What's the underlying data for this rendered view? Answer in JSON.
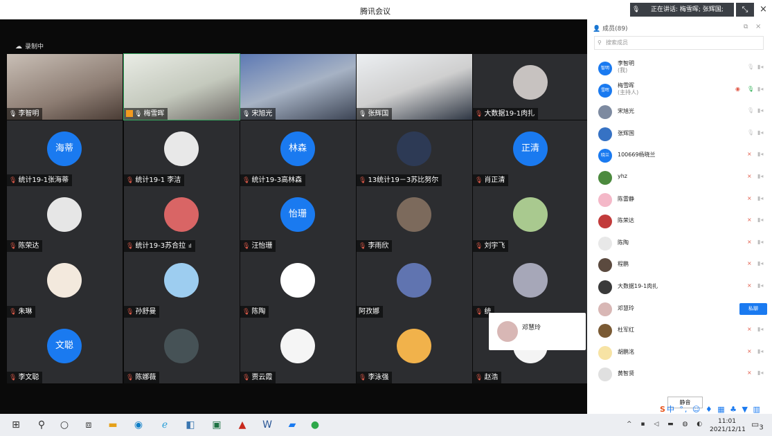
{
  "window": {
    "title": "腾讯会议",
    "speaking_text": "正在讲话: 梅雪晖; 张辉国;",
    "close": "×"
  },
  "recording": "录制中",
  "tiles": [
    {
      "name": "李智明",
      "kind": "camera",
      "mic": "white"
    },
    {
      "name": "梅雪晖",
      "kind": "camera",
      "mic": "white",
      "host": true
    },
    {
      "name": "宋旭光",
      "kind": "camera",
      "mic": "white"
    },
    {
      "name": "张辉国",
      "kind": "camera",
      "mic": "white"
    },
    {
      "name": "大数据19-1肉扎",
      "kind": "avatar",
      "mic": "red",
      "avatar_color": "#c7c2c0"
    },
    {
      "name": "统计19-1张海蒂",
      "kind": "text",
      "avatar_text": "海蒂",
      "mic": "red"
    },
    {
      "name": "统计19-1 李洁",
      "kind": "avatar",
      "mic": "red",
      "avatar_color": "#e8e8e8"
    },
    {
      "name": "统计19-3高林森",
      "kind": "text",
      "avatar_text": "林森",
      "mic": "red"
    },
    {
      "name": "13统计19－3苏比努尔",
      "kind": "avatar",
      "mic": "red",
      "avatar_color": "#2d3a55"
    },
    {
      "name": "肖正清",
      "kind": "text",
      "avatar_text": "正清",
      "mic": "red"
    },
    {
      "name": "陈荣达",
      "kind": "avatar",
      "mic": "red",
      "avatar_color": "#e6e6e6"
    },
    {
      "name": "统计19-3苏合拉",
      "kind": "avatar",
      "mic": "red",
      "avatar_color": "#d96565",
      "signal": "ıl"
    },
    {
      "name": "汪怡珊",
      "kind": "text",
      "avatar_text": "怡珊",
      "mic": "red"
    },
    {
      "name": "李雨欣",
      "kind": "avatar",
      "mic": "red",
      "avatar_color": "#7c6a5c"
    },
    {
      "name": "刘宇飞",
      "kind": "avatar",
      "mic": "red",
      "avatar_color": "#a9c98f"
    },
    {
      "name": "朱琳",
      "kind": "avatar",
      "mic": "red",
      "avatar_color": "#f3e9dd"
    },
    {
      "name": "孙舒曼",
      "kind": "avatar",
      "mic": "red",
      "avatar_color": "#9dcdf0"
    },
    {
      "name": "陈陶",
      "kind": "avatar",
      "mic": "red",
      "avatar_color": "#ffffff"
    },
    {
      "name": "阿孜娜",
      "kind": "avatar",
      "mic": "none",
      "avatar_color": "#6074b0"
    },
    {
      "name": "统",
      "kind": "avatar",
      "mic": "red",
      "avatar_color": "#a6a7b8"
    },
    {
      "name": "李文聪",
      "kind": "text",
      "avatar_text": "文聪",
      "mic": "red"
    },
    {
      "name": "陈娜薇",
      "kind": "avatar",
      "mic": "red",
      "avatar_color": "#465256"
    },
    {
      "name": "贾云霞",
      "kind": "avatar",
      "mic": "red",
      "avatar_color": "#f5f5f5"
    },
    {
      "name": "李泳强",
      "kind": "avatar",
      "mic": "red",
      "avatar_color": "#f1b24b"
    },
    {
      "name": "赵浩",
      "kind": "avatar",
      "mic": "red",
      "avatar_color": "#f4f4f4"
    }
  ],
  "popup": {
    "name": "邓慧玲"
  },
  "panel": {
    "title": "成员(89)",
    "search_placeholder": "搜索成员",
    "mute_all": "静音",
    "members": [
      {
        "name": "李智明",
        "sub": "(我)",
        "avatar_text": "智明",
        "blue": true,
        "mic": "grey"
      },
      {
        "name": "梅雪晖",
        "sub": "(主持人)",
        "avatar_text": "雪晖",
        "blue": true,
        "mic": "green",
        "share": true
      },
      {
        "name": "宋旭光",
        "avatar_color": "#7d8aa0",
        "mic": "grey"
      },
      {
        "name": "张辉国",
        "avatar_color": "#3672c4",
        "mic": "grey"
      },
      {
        "name": "100669杨晓兰",
        "avatar_text": "晓兰",
        "blue": true,
        "mic": "red"
      },
      {
        "name": "yhz",
        "avatar_color": "#4c8a3e",
        "mic": "red"
      },
      {
        "name": "陈雷静",
        "avatar_color": "#f4b8c8",
        "mic": "red"
      },
      {
        "name": "陈荣达",
        "avatar_color": "#c23b3b",
        "mic": "red"
      },
      {
        "name": "陈陶",
        "avatar_color": "#e8e8e8",
        "mic": "red"
      },
      {
        "name": "程鹏",
        "avatar_color": "#5b4a3f",
        "mic": "red"
      },
      {
        "name": "大数据19-1肉扎",
        "avatar_color": "#3a3a3a",
        "mic": "red"
      },
      {
        "name": "邓慧玲",
        "avatar_color": "#d8b7b5",
        "chat": "私聊"
      },
      {
        "name": "杜军红",
        "avatar_color": "#7a5a34",
        "mic": "red"
      },
      {
        "name": "胡鹏洺",
        "avatar_color": "#f7e3a4",
        "mic": "red"
      },
      {
        "name": "黄智贤",
        "avatar_color": "#e0e0e0",
        "mic": "red"
      }
    ]
  },
  "ime_text": "中 °, ☺ ♦ ▦ ♣ ▼ ▥",
  "taskbar": {
    "time": "11:01",
    "date": "2021/12/11",
    "notify": "3"
  },
  "colors": {
    "accent": "#1a7af0",
    "muted_mic": "#e15b4a",
    "speaking": "#35b25a"
  }
}
